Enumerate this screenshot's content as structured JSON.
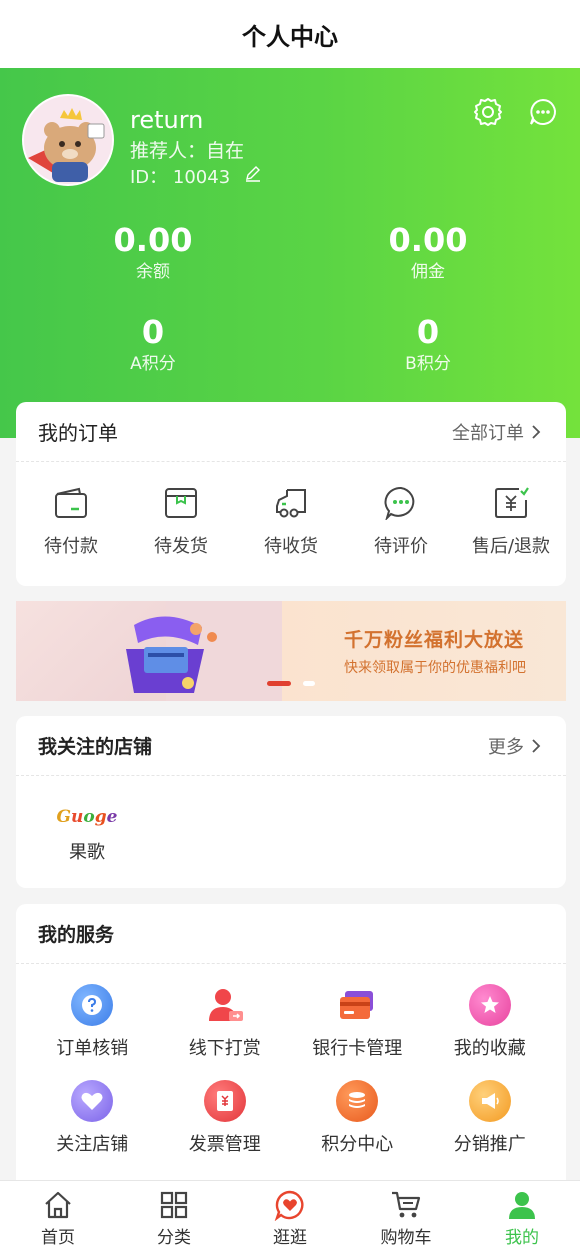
{
  "header": {
    "title": "个人中心"
  },
  "profile": {
    "username": "return",
    "referrer": "推荐人：自在",
    "id": "ID：  10043"
  },
  "stats": [
    {
      "value": "0.00",
      "label": "余额"
    },
    {
      "value": "0.00",
      "label": "佣金"
    },
    {
      "value": "0",
      "label": "A积分"
    },
    {
      "value": "0",
      "label": "B积分"
    }
  ],
  "orders": {
    "title": "我的订单",
    "all_label": "全部订单",
    "items": [
      {
        "label": "待付款",
        "icon": "wallet-icon"
      },
      {
        "label": "待发货",
        "icon": "box-icon"
      },
      {
        "label": "待收货",
        "icon": "truck-icon"
      },
      {
        "label": "待评价",
        "icon": "comment-icon"
      },
      {
        "label": "售后/退款",
        "icon": "refund-icon"
      }
    ]
  },
  "banner": {
    "title": "千万粉丝福利大放送",
    "subtitle": "快来领取属于你的优惠福利吧",
    "active_dot": 1,
    "dot_count": 2
  },
  "shops": {
    "title": "我关注的店铺",
    "more_label": "更多",
    "items": [
      {
        "name": "果歌",
        "logo_text": "Guoge"
      }
    ]
  },
  "services": {
    "title": "我的服务",
    "items": [
      {
        "label": "订单核销",
        "icon": "question-icon",
        "color": "#4a8df0"
      },
      {
        "label": "线下打赏",
        "icon": "user-reward-icon",
        "color": "#f0464a"
      },
      {
        "label": "银行卡管理",
        "icon": "bank-card-icon",
        "color": "#ef5a3a"
      },
      {
        "label": "我的收藏",
        "icon": "star-icon",
        "color": "#f04ea5"
      },
      {
        "label": "关注店铺",
        "icon": "heart-icon",
        "color": "#8c79ef"
      },
      {
        "label": "发票管理",
        "icon": "invoice-icon",
        "color": "#f2474a"
      },
      {
        "label": "积分中心",
        "icon": "coins-icon",
        "color": "#f26a2a"
      },
      {
        "label": "分销推广",
        "icon": "megaphone-icon",
        "color": "#f6a52b"
      }
    ]
  },
  "tabbar": {
    "items": [
      {
        "label": "首页",
        "icon": "home-icon"
      },
      {
        "label": "分类",
        "icon": "grid-icon"
      },
      {
        "label": "逛逛",
        "icon": "heart-chat-icon"
      },
      {
        "label": "购物车",
        "icon": "cart-icon"
      },
      {
        "label": "我的",
        "icon": "person-icon"
      }
    ],
    "active_index": 4,
    "active_color": "#3cc34c"
  }
}
